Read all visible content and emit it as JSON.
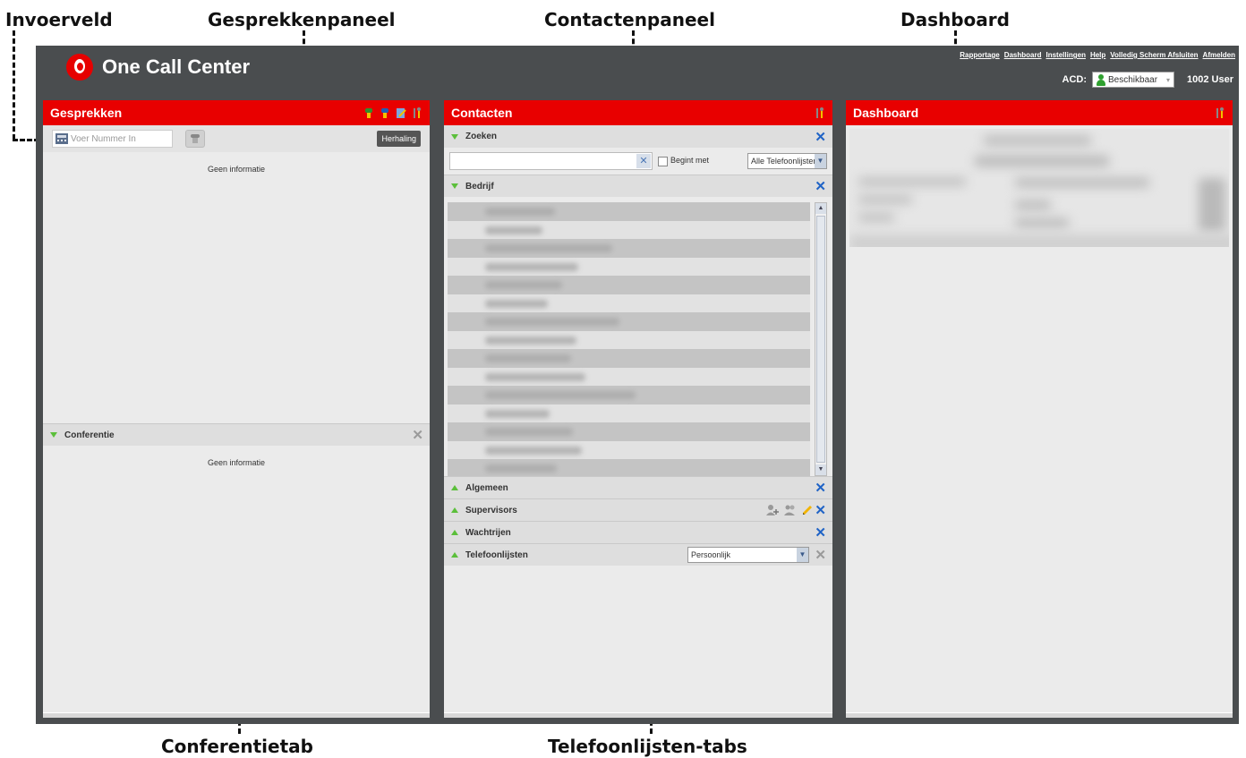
{
  "annotations": {
    "invoerveld": "Invoerveld",
    "gesprekkenpaneel": "Gesprekkenpaneel",
    "contactenpaneel": "Contactenpaneel",
    "dashboard": "Dashboard",
    "conferentietab": "Conferentietab",
    "telefoonlijsten_tabs": "Telefoonlijsten-tabs"
  },
  "app": {
    "brand": "One Call Center",
    "brand_color": "#e60000",
    "top_links": [
      "Rapportage",
      "Dashboard",
      "Instellingen",
      "Help",
      "Volledig Scherm Afsluiten",
      "Afmelden"
    ],
    "acd_label": "ACD:",
    "acd_status": "Beschikbaar",
    "user": "1002 User"
  },
  "left_panel": {
    "title": "Gesprekken",
    "dial_placeholder": "Voer Nummer In",
    "repeat_button": "Herhaling",
    "empty_text": "Geen informatie",
    "conference": {
      "title": "Conferentie",
      "empty_text": "Geen informatie"
    }
  },
  "mid_panel": {
    "title": "Contacten",
    "sections": {
      "zoeken": "Zoeken",
      "begint_met": "Begint met",
      "phonebook_filter": "Alle Telefoonlijsten",
      "bedrijf": "Bedrijf",
      "algemeen": "Algemeen",
      "supervisors": "Supervisors",
      "wachtrijen": "Wachtrijen",
      "telefoonlijsten": "Telefoonlijsten",
      "telefoonlijsten_select": "Persoonlijk"
    }
  },
  "right_panel": {
    "title": "Dashboard"
  }
}
